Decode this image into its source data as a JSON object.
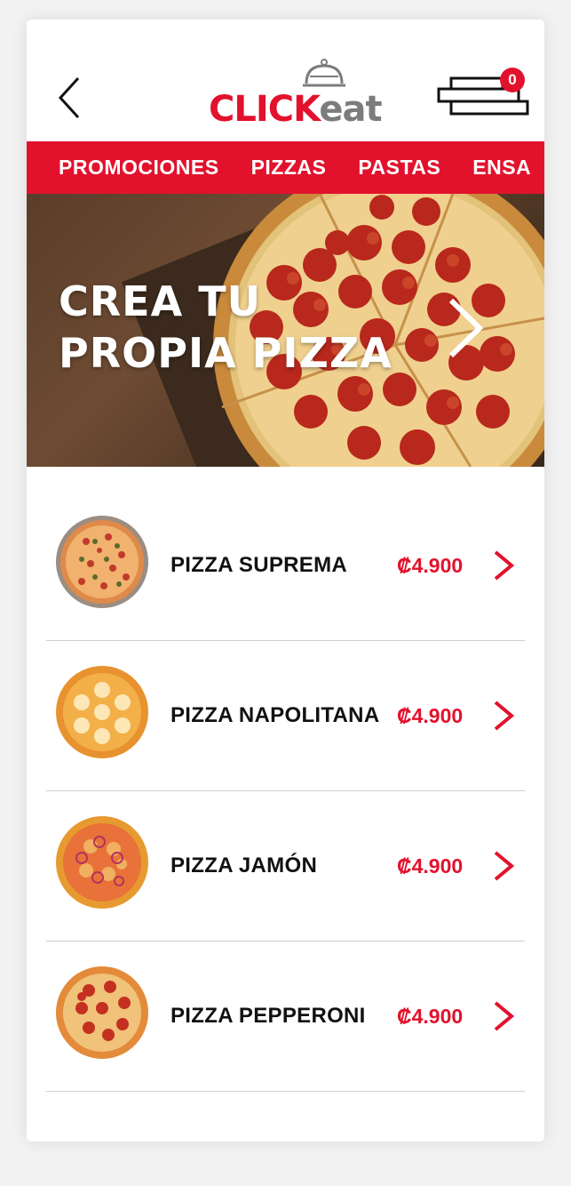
{
  "header": {
    "logo_part1": "CLI",
    "logo_fork": "C",
    "logo_part2": "K",
    "logo_part3": "eat",
    "cart_count": "0"
  },
  "nav": {
    "items": [
      "PROMOCIONES",
      "PIZZAS",
      "PASTAS",
      "ENSA"
    ]
  },
  "banner": {
    "line1": "CREA TU",
    "line2": "PROPIA PIZZA"
  },
  "products": [
    {
      "name": "PIZZA SUPREMA",
      "price": "₡4.900"
    },
    {
      "name": "PIZZA NAPOLITANA",
      "price": "₡4.900"
    },
    {
      "name": "PIZZA JAMÓN",
      "price": "₡4.900"
    },
    {
      "name": "PIZZA PEPPERONI",
      "price": "₡4.900"
    }
  ],
  "colors": {
    "accent": "#e2122d",
    "logo_gray": "#7c7c7c"
  },
  "icons": [
    "back-chevron-icon",
    "cloche-icon",
    "cart-icon",
    "chevron-right-icon"
  ]
}
